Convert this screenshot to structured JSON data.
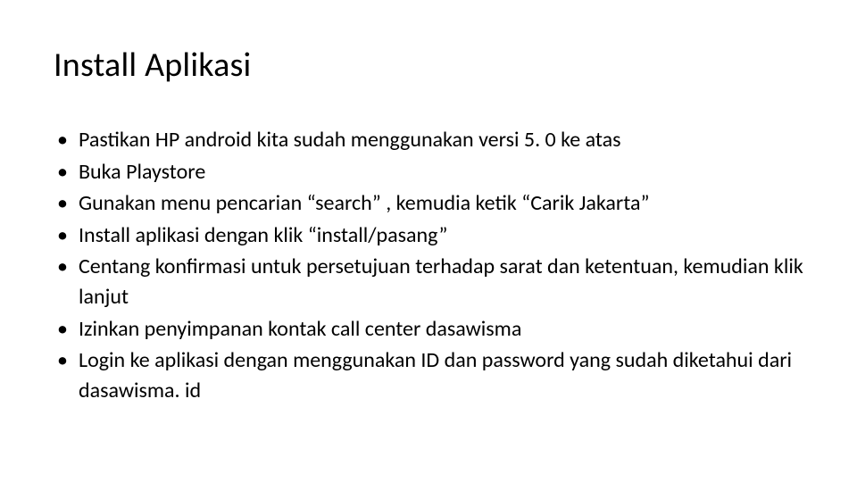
{
  "slide": {
    "title": "Install Aplikasi",
    "bullets": [
      "Pastikan HP android kita sudah menggunakan versi 5. 0 ke atas",
      "Buka Playstore",
      "Gunakan menu pencarian “search” , kemudia ketik “Carik Jakarta”",
      "Install aplikasi dengan klik “install/pasang”",
      "Centang konfirmasi untuk persetujuan terhadap sarat dan ketentuan, kemudian klik lanjut",
      "Izinkan penyimpanan kontak call center dasawisma",
      "Login ke aplikasi dengan menggunakan ID dan password yang sudah diketahui dari dasawisma. id"
    ]
  }
}
